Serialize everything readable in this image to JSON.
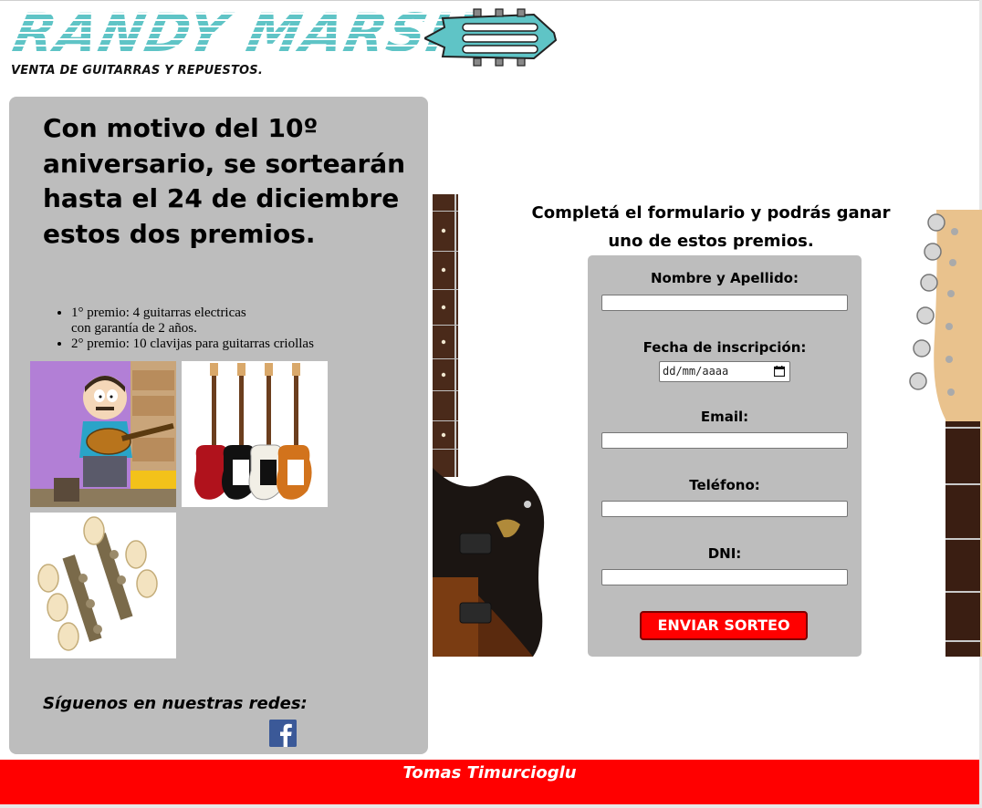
{
  "brand": {
    "logo_text": "RANDY MARSH",
    "tagline": "VENTA DE GUITARRAS Y REPUESTOS.",
    "accent_color": "#5fc4c6"
  },
  "promo": {
    "title": "Con motivo del 10º aniversario, se sortearán hasta el 24 de diciembre estos dos premios.",
    "prizes": [
      {
        "line1": "1° premio: 4 guitarras electricas",
        "line2": "con garantía de 2 años."
      },
      {
        "line1": "2° premio: 10 clavijas para guitarras criollas",
        "line2": ""
      }
    ],
    "images": [
      "randy-marsh-guitar-image",
      "four-electric-guitars-image",
      "classical-tuning-pegs-image"
    ]
  },
  "social": {
    "title": "Síguenos en nuestras redes:",
    "icon": "facebook-icon",
    "icon_color": "#3b5998"
  },
  "form": {
    "heading_line1": "Completá el formulario y podrás ganar",
    "heading_line2": "uno de estos premios.",
    "fields": [
      {
        "label": "Nombre y Apellido:",
        "value": ""
      },
      {
        "label": "Fecha de inscripción:",
        "value": "dd/mm/aaaa"
      },
      {
        "label": "Email:",
        "value": ""
      },
      {
        "label": "Teléfono:",
        "value": ""
      },
      {
        "label": "DNI:",
        "value": ""
      }
    ],
    "submit_label": "ENVIAR SORTEO",
    "submit_color": "#ff0000"
  },
  "footer": {
    "author": "Tomas Timurcioglu",
    "background_color": "#ff0000"
  },
  "panel_color": "#bdbdbd"
}
